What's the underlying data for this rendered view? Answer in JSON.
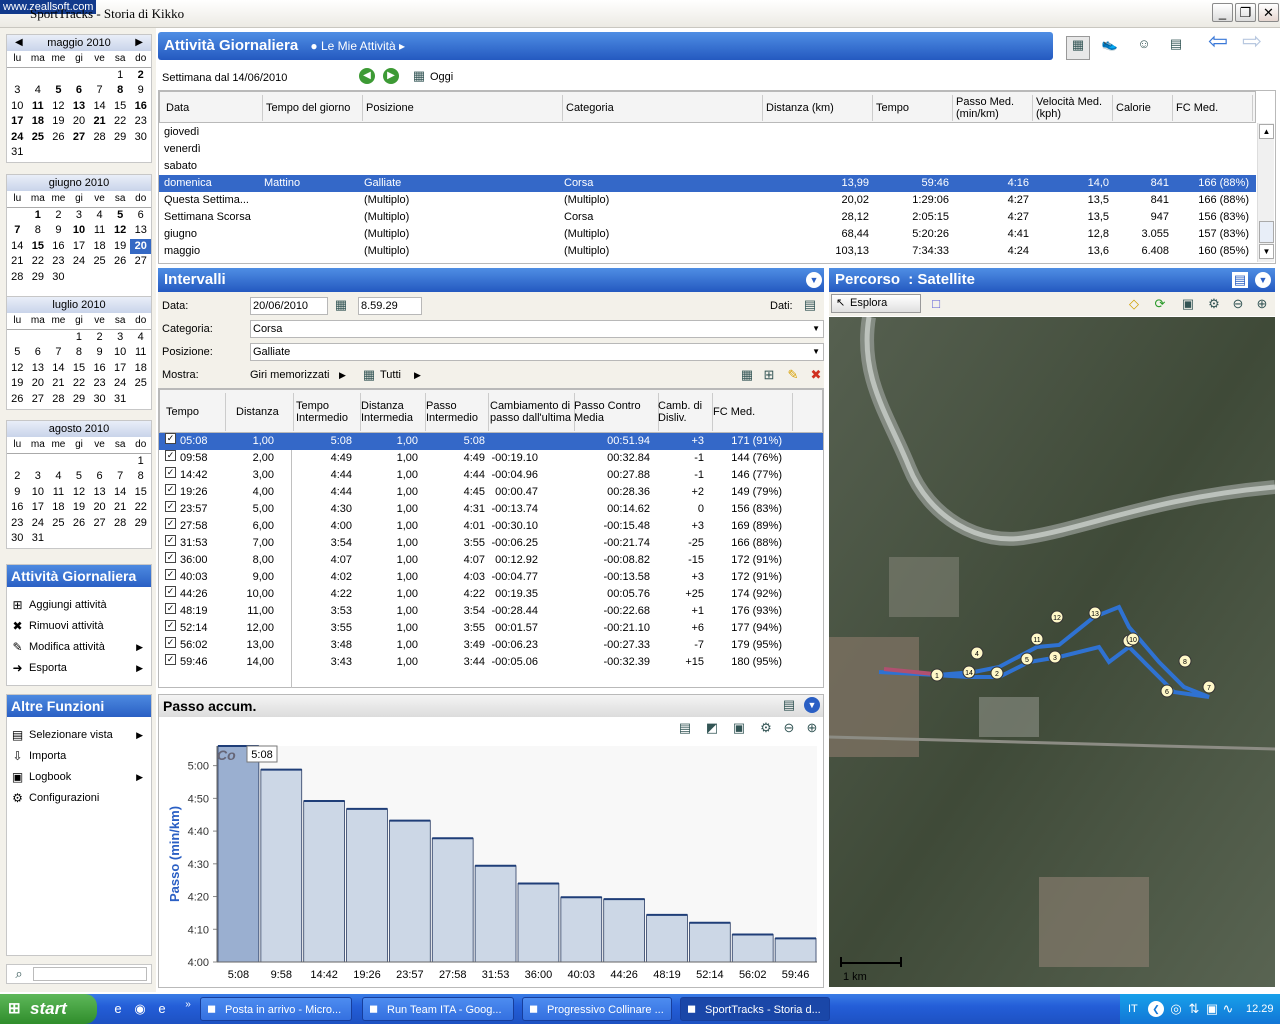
{
  "title_bar": {
    "watermark": "www.zeallsoft.com",
    "title": "SportTracks - Storia di Kikko"
  },
  "calendars": [
    {
      "month": "maggio 2010",
      "days": [
        "lu",
        "ma",
        "me",
        "gi",
        "ve",
        "sa",
        "do"
      ],
      "cells": [
        "",
        "",
        "",
        "",
        "",
        "1",
        "2",
        "3",
        "4",
        "5",
        "6",
        "7",
        "8",
        "9",
        "10",
        "11",
        "12",
        "13",
        "14",
        "15",
        "16",
        "17",
        "18",
        "19",
        "20",
        "21",
        "22",
        "23",
        "24",
        "25",
        "26",
        "27",
        "28",
        "29",
        "30",
        "31",
        "",
        "",
        "",
        "",
        "",
        ""
      ],
      "bold": [
        "2",
        "5",
        "6",
        "8",
        "11",
        "13",
        "16",
        "17",
        "18",
        "21",
        "24",
        "25",
        "27"
      ]
    },
    {
      "month": "giugno 2010",
      "days": [
        "lu",
        "ma",
        "me",
        "gi",
        "ve",
        "sa",
        "do"
      ],
      "cells": [
        "",
        "1",
        "2",
        "3",
        "4",
        "5",
        "6",
        "7",
        "8",
        "9",
        "10",
        "11",
        "12",
        "13",
        "14",
        "15",
        "16",
        "17",
        "18",
        "19",
        "20",
        "21",
        "22",
        "23",
        "24",
        "25",
        "26",
        "27",
        "28",
        "29",
        "30",
        "",
        "",
        "",
        "",
        ""
      ],
      "bold": [
        "1",
        "5",
        "7",
        "10",
        "12",
        "15"
      ],
      "selected": "20"
    },
    {
      "month": "luglio 2010",
      "days": [
        "lu",
        "ma",
        "me",
        "gi",
        "ve",
        "sa",
        "do"
      ],
      "cells": [
        "",
        "",
        "",
        "1",
        "2",
        "3",
        "4",
        "5",
        "6",
        "7",
        "8",
        "9",
        "10",
        "11",
        "12",
        "13",
        "14",
        "15",
        "16",
        "17",
        "18",
        "19",
        "20",
        "21",
        "22",
        "23",
        "24",
        "25",
        "26",
        "27",
        "28",
        "29",
        "30",
        "31",
        ""
      ]
    },
    {
      "month": "agosto 2010",
      "days": [
        "lu",
        "ma",
        "me",
        "gi",
        "ve",
        "sa",
        "do"
      ],
      "cells": [
        "",
        "",
        "",
        "",
        "",
        "",
        "1",
        "2",
        "3",
        "4",
        "5",
        "6",
        "7",
        "8",
        "9",
        "10",
        "11",
        "12",
        "13",
        "14",
        "15",
        "16",
        "17",
        "18",
        "19",
        "20",
        "21",
        "22",
        "23",
        "24",
        "25",
        "26",
        "27",
        "28",
        "29",
        "30",
        "31",
        "",
        "",
        "",
        "",
        ""
      ]
    }
  ],
  "activity_panel": {
    "title": "Attività Giornaliera",
    "items": [
      {
        "label": "Aggiungi attività",
        "icon": "add-icon",
        "glyph": "⊞",
        "sub": ""
      },
      {
        "label": "Rimuovi attività",
        "icon": "remove-icon",
        "glyph": "✖",
        "sub": ""
      },
      {
        "label": "Modifica attività",
        "icon": "pencil-icon",
        "glyph": "✎",
        "sub": "▶"
      },
      {
        "label": "Esporta",
        "icon": "export-icon",
        "glyph": "➜",
        "sub": "▶"
      }
    ]
  },
  "other_panel": {
    "title": "Altre Funzioni",
    "items": [
      {
        "label": "Selezionare vista",
        "icon": "view-icon",
        "glyph": "▤",
        "sub": "▶"
      },
      {
        "label": "Importa",
        "icon": "import-icon",
        "glyph": "⇩",
        "sub": ""
      },
      {
        "label": "Logbook",
        "icon": "logbook-icon",
        "glyph": "▣",
        "sub": "▶"
      },
      {
        "label": "Configurazioni",
        "icon": "settings-icon",
        "glyph": "⚙",
        "sub": ""
      }
    ]
  },
  "header": {
    "title": "Attività Giornaliera",
    "crumb": "Le Mie Attività"
  },
  "week": {
    "label": "Settimana dal 14/06/2010",
    "today": "Oggi"
  },
  "activity_table": {
    "columns": [
      "Data",
      "Tempo del giorno",
      "Posizione",
      "Categoria",
      "Distanza (km)",
      "Tempo",
      "Passo Med. (min/km)",
      "Velocità Med. (kph)",
      "Calorie",
      "FC Med."
    ],
    "rows": [
      [
        "giovedì",
        "",
        "",
        "",
        "",
        "",
        "",
        "",
        "",
        ""
      ],
      [
        "venerdì",
        "",
        "",
        "",
        "",
        "",
        "",
        "",
        "",
        ""
      ],
      [
        "sabato",
        "",
        "",
        "",
        "",
        "",
        "",
        "",
        "",
        ""
      ],
      [
        "domenica",
        "Mattino",
        "Galliate",
        "Corsa",
        "13,99",
        "59:46",
        "4:16",
        "14,0",
        "841",
        "166 (88%)"
      ],
      [
        "Questa Settima...",
        "",
        "(Multiplo)",
        "(Multiplo)",
        "20,02",
        "1:29:06",
        "4:27",
        "13,5",
        "841",
        "166 (88%)"
      ],
      [
        "Settimana Scorsa",
        "",
        "(Multiplo)",
        "Corsa",
        "28,12",
        "2:05:15",
        "4:27",
        "13,5",
        "947",
        "156 (83%)"
      ],
      [
        "giugno",
        "",
        "(Multiplo)",
        "(Multiplo)",
        "68,44",
        "5:20:26",
        "4:41",
        "12,8",
        "3.055",
        "157 (83%)"
      ],
      [
        "maggio",
        "",
        "(Multiplo)",
        "(Multiplo)",
        "103,13",
        "7:34:33",
        "4:24",
        "13,6",
        "6.408",
        "160 (85%)"
      ]
    ],
    "selected_row": 3
  },
  "intervals": {
    "title": "Intervalli",
    "data_label": "Data:",
    "date": "20/06/2010",
    "time": "8.59.29",
    "dati_label": "Dati:",
    "categoria_label": "Categoria:",
    "categoria": "Corsa",
    "posizione_label": "Posizione:",
    "posizione": "Galliate",
    "mostra_label": "Mostra:",
    "mostra": "Giri memorizzati",
    "tutti": "Tutti",
    "columns": [
      "Tempo",
      "Distanza",
      "Tempo Intermedio",
      "Distanza Intermedia",
      "Passo Intermedio",
      "Cambiamento di passo dall'ultima",
      "Passo Contro Media",
      "Camb. di Disliv.",
      "FC Med."
    ],
    "rows": [
      [
        "05:08",
        "1,00",
        "5:08",
        "1,00",
        "5:08",
        "",
        "00:51.94",
        "+3",
        "171 (91%)"
      ],
      [
        "09:58",
        "2,00",
        "4:49",
        "1,00",
        "4:49",
        "-00:19.10",
        "00:32.84",
        "-1",
        "144 (76%)"
      ],
      [
        "14:42",
        "3,00",
        "4:44",
        "1,00",
        "4:44",
        "-00:04.96",
        "00:27.88",
        "-1",
        "146 (77%)"
      ],
      [
        "19:26",
        "4,00",
        "4:44",
        "1,00",
        "4:45",
        "00:00.47",
        "00:28.36",
        "+2",
        "149 (79%)"
      ],
      [
        "23:57",
        "5,00",
        "4:30",
        "1,00",
        "4:31",
        "-00:13.74",
        "00:14.62",
        "0",
        "156 (83%)"
      ],
      [
        "27:58",
        "6,00",
        "4:00",
        "1,00",
        "4:01",
        "-00:30.10",
        "-00:15.48",
        "+3",
        "169 (89%)"
      ],
      [
        "31:53",
        "7,00",
        "3:54",
        "1,00",
        "3:55",
        "-00:06.25",
        "-00:21.74",
        "-25",
        "166 (88%)"
      ],
      [
        "36:00",
        "8,00",
        "4:07",
        "1,00",
        "4:07",
        "00:12.92",
        "-00:08.82",
        "-15",
        "172 (91%)"
      ],
      [
        "40:03",
        "9,00",
        "4:02",
        "1,00",
        "4:03",
        "-00:04.77",
        "-00:13.58",
        "+3",
        "172 (91%)"
      ],
      [
        "44:26",
        "10,00",
        "4:22",
        "1,00",
        "4:22",
        "00:19.35",
        "00:05.76",
        "+25",
        "174 (92%)"
      ],
      [
        "48:19",
        "11,00",
        "3:53",
        "1,00",
        "3:54",
        "-00:28.44",
        "-00:22.68",
        "+1",
        "176 (93%)"
      ],
      [
        "52:14",
        "12,00",
        "3:55",
        "1,00",
        "3:55",
        "00:01.57",
        "-00:21.10",
        "+6",
        "177 (94%)"
      ],
      [
        "56:02",
        "13,00",
        "3:48",
        "1,00",
        "3:49",
        "-00:06.23",
        "-00:27.33",
        "-7",
        "179 (95%)"
      ],
      [
        "59:46",
        "14,00",
        "3:43",
        "1,00",
        "3:44",
        "-00:05.06",
        "-00:32.39",
        "+15",
        "180 (95%)"
      ]
    ],
    "selected_row": 0
  },
  "chart_panel": {
    "title": "Passo accum.",
    "tooltip": "5:08",
    "legend_stub": "Co"
  },
  "chart_data": {
    "type": "bar",
    "ylabel": "Passo (min/km)",
    "categories": [
      "5:08",
      "9:58",
      "14:42",
      "19:26",
      "23:57",
      "27:58",
      "31:53",
      "36:00",
      "40:03",
      "44:26",
      "48:19",
      "52:14",
      "56:02",
      "59:46"
    ],
    "values": [
      5.1,
      4.98,
      4.82,
      4.78,
      4.72,
      4.63,
      4.49,
      4.4,
      4.33,
      4.32,
      4.24,
      4.2,
      4.14,
      4.12
    ],
    "yticks": [
      "4:00",
      "4:10",
      "4:20",
      "4:30",
      "4:40",
      "4:50",
      "5:00"
    ],
    "ylim": [
      4.0,
      5.1
    ],
    "bar_color": "#ccd7e6",
    "selected_color": "#9aafd0",
    "selected_index": 0,
    "grid": false
  },
  "map": {
    "title": "Percorso",
    "subtitle": ": Satellite",
    "explore": "Esplora",
    "scale": "1 km",
    "markers": [
      "1",
      "2",
      "3",
      "4",
      "5",
      "6",
      "7",
      "8",
      "9",
      "10",
      "11",
      "12",
      "13",
      "14"
    ]
  },
  "taskbar": {
    "start": "start",
    "tasks": [
      "Posta in arrivo - Micro...",
      "Run Team ITA - Goog...",
      "Progressivo Collinare ...",
      "SportTracks - Storia d..."
    ],
    "lang": "IT",
    "clock": "12.29"
  }
}
